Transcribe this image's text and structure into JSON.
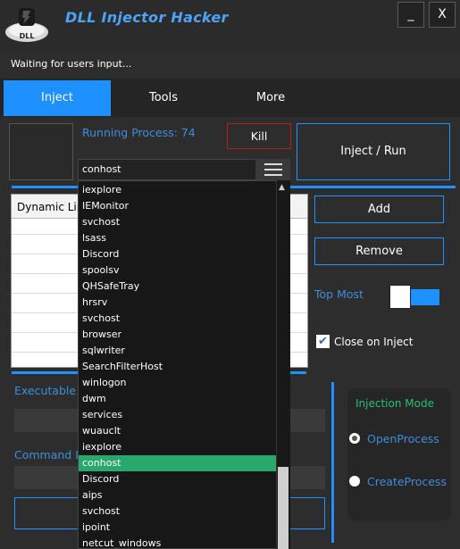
{
  "window": {
    "title": "DLL Injector Hacker",
    "logo_text": "DLL",
    "minimize_label": "_",
    "close_label": "X"
  },
  "status": "Waiting for users input...",
  "tabs": [
    {
      "label": "Inject",
      "active": true
    },
    {
      "label": "Tools",
      "active": false
    },
    {
      "label": "More",
      "active": false
    }
  ],
  "main": {
    "running_process": "Running Process: 74",
    "kill_label": "Kill",
    "inject_run_label": "Inject / Run",
    "process_selected": "conhost",
    "grid_header": "Dynamic Lin",
    "add_label": "Add",
    "remove_label": "Remove",
    "top_most_label": "Top Most",
    "top_most_on": true,
    "close_on_inject_label": "Close on Inject",
    "close_on_inject_checked": true,
    "executable_label": "Executable",
    "command_label": "Command L"
  },
  "injection_mode": {
    "title": "Injection Mode",
    "options": [
      "OpenProcess",
      "CreateProcess"
    ],
    "selected": "OpenProcess"
  },
  "dropdown": {
    "items": [
      "iexplore",
      "IEMonitor",
      "svchost",
      "lsass",
      "Discord",
      "spoolsv",
      "QHSafeTray",
      "hrsrv",
      "svchost",
      "browser",
      "sqlwriter",
      "SearchFilterHost",
      "winlogon",
      "dwm",
      "services",
      "wuauclt",
      "iexplore",
      "conhost",
      "Discord",
      "aips",
      "svchost",
      "ipoint",
      "netcut_windows"
    ],
    "selected_index": 17
  },
  "colors": {
    "accent": "#1e90ff",
    "link_blue": "#3d8de0",
    "kill_border": "#b81e1e",
    "selection_green": "#2aa86c",
    "mode_title_green": "#2bbf74",
    "background": "#2d2d2d"
  }
}
